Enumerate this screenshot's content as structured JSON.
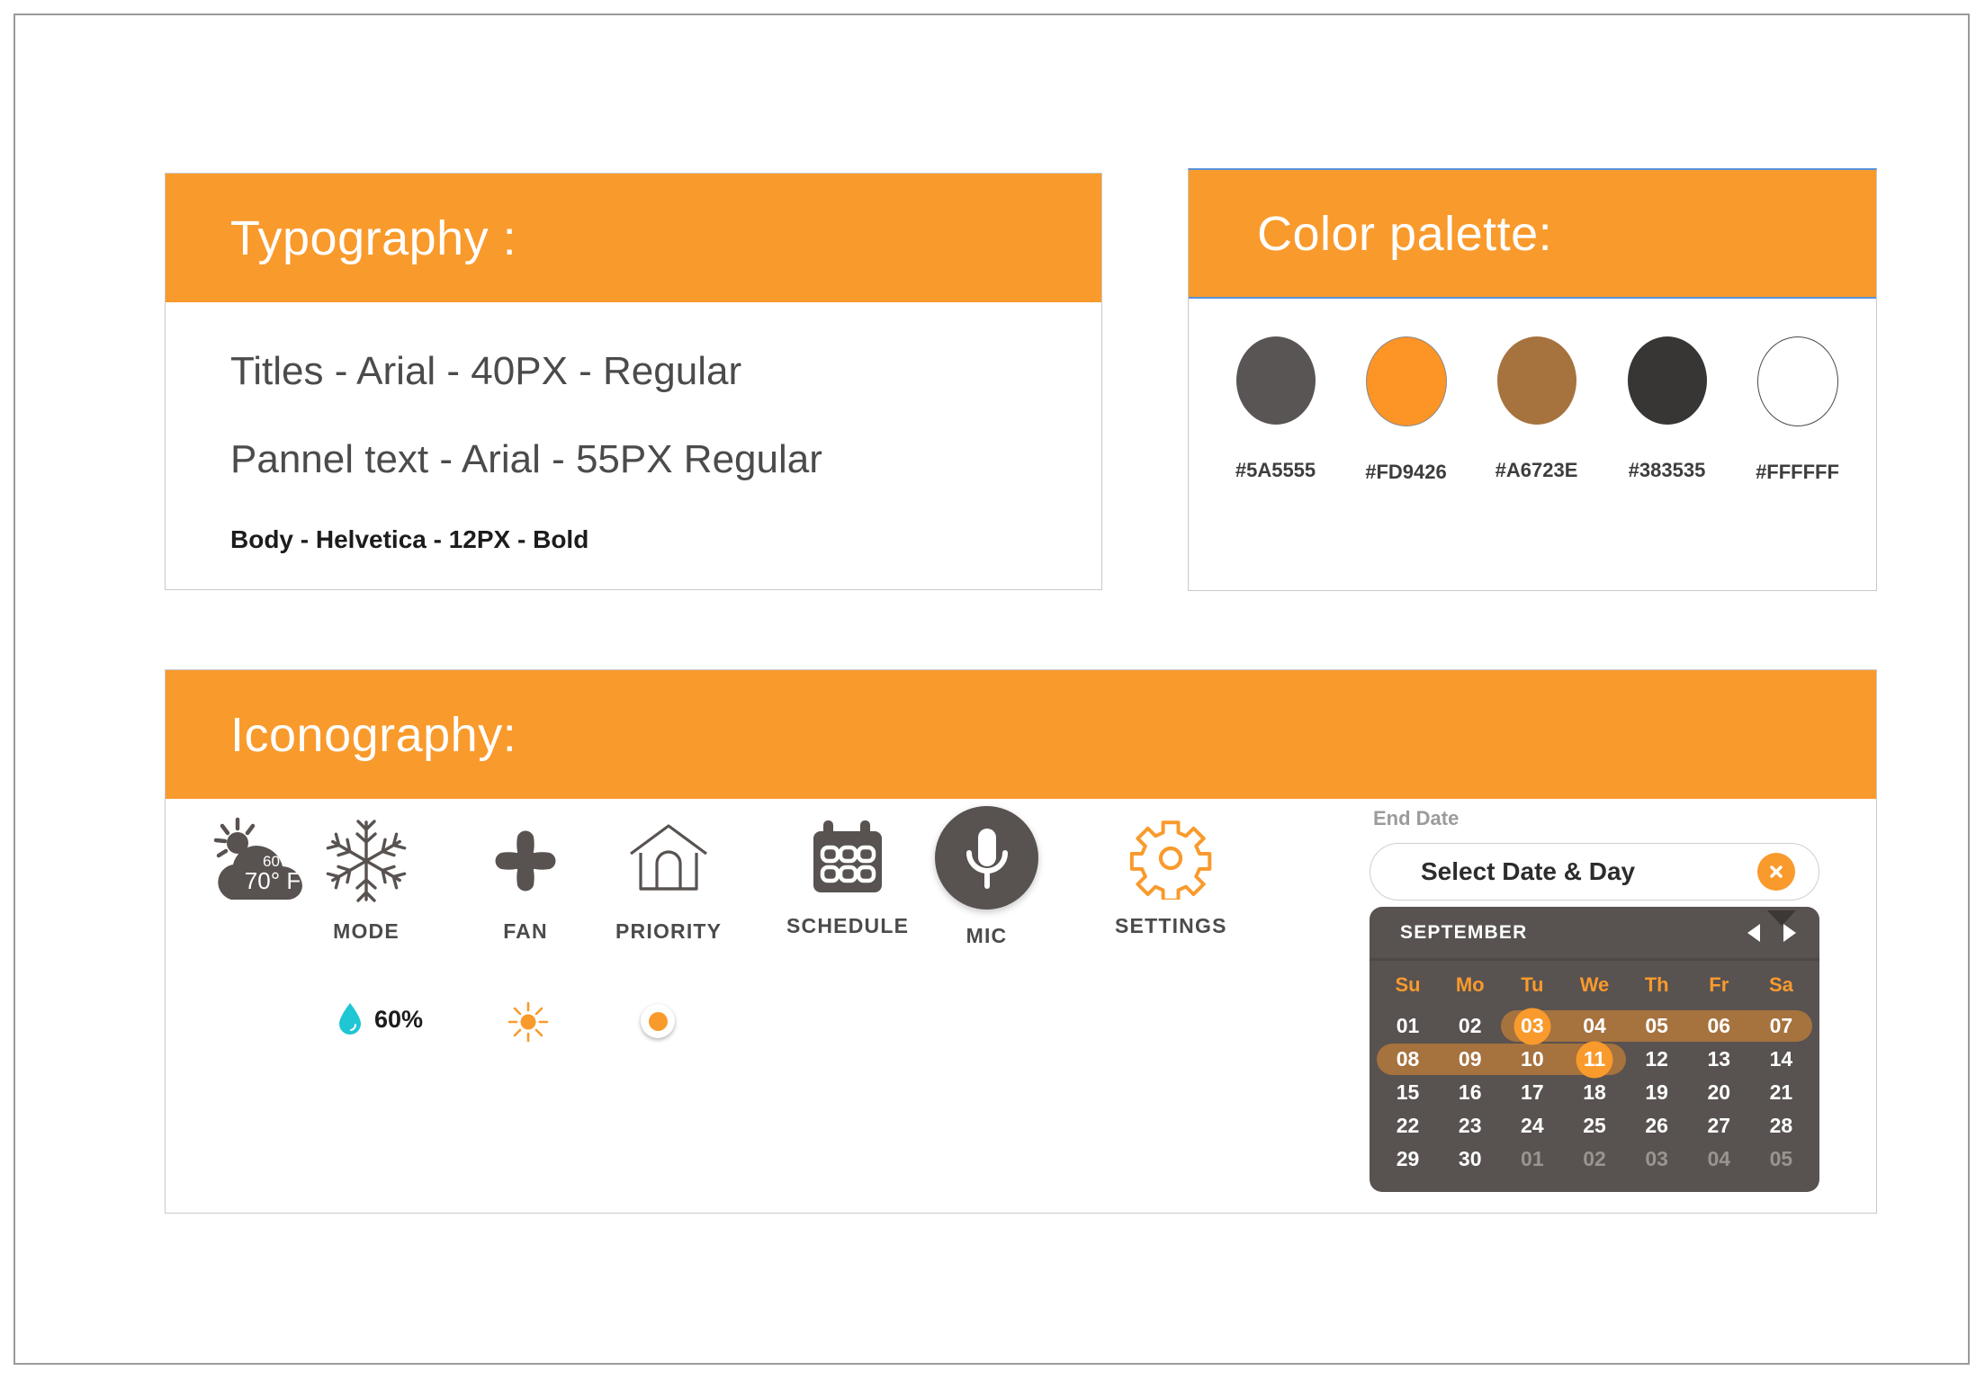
{
  "typography": {
    "header": "Typography :",
    "lines": [
      "Titles - Arial - 40PX - Regular",
      "Pannel text - Arial - 55PX Regular",
      "Body - Helvetica - 12PX - Bold"
    ]
  },
  "palette": {
    "header": "Color palette:",
    "swatches": [
      {
        "hex": "#5A5555",
        "label": "#5A5555"
      },
      {
        "hex": "#FD9426",
        "label": "#FD9426"
      },
      {
        "hex": "#A6723E",
        "label": "#A6723E"
      },
      {
        "hex": "#383535",
        "label": "#383535"
      },
      {
        "hex": "#FFFFFF",
        "label": "#FFFFFF"
      }
    ]
  },
  "iconography": {
    "header": "Iconography:",
    "weather": {
      "humidity": "60%",
      "temperature": "70° F"
    },
    "icons": [
      {
        "name": "weather-icon",
        "caption": ""
      },
      {
        "name": "snowflake-icon",
        "caption": "MODE"
      },
      {
        "name": "fan-icon",
        "caption": "FAN"
      },
      {
        "name": "house-icon",
        "caption": "PRIORITY"
      },
      {
        "name": "calendar-icon",
        "caption": "SCHEDULE"
      },
      {
        "name": "microphone-icon",
        "caption": "MIC"
      },
      {
        "name": "gear-icon",
        "caption": "SETTINGS"
      }
    ],
    "mini": {
      "humidity_value": "60%"
    }
  },
  "datepicker": {
    "label": "End Date",
    "input_value": "Select Date & Day",
    "month": "SEPTEMBER",
    "dow": [
      "Su",
      "Mo",
      "Tu",
      "We",
      "Th",
      "Fr",
      "Sa"
    ],
    "weeks": [
      [
        {
          "d": "01"
        },
        {
          "d": "02"
        },
        {
          "d": "03",
          "state": "range-start"
        },
        {
          "d": "04",
          "state": "inrange"
        },
        {
          "d": "05",
          "state": "inrange"
        },
        {
          "d": "06",
          "state": "inrange"
        },
        {
          "d": "07",
          "state": "range-end"
        }
      ],
      [
        {
          "d": "08",
          "state": "range-start-row"
        },
        {
          "d": "09",
          "state": "inrange"
        },
        {
          "d": "10",
          "state": "inrange"
        },
        {
          "d": "11",
          "state": "range-end-sel"
        },
        {
          "d": "12"
        },
        {
          "d": "13"
        },
        {
          "d": "14"
        }
      ],
      [
        {
          "d": "15"
        },
        {
          "d": "16"
        },
        {
          "d": "17"
        },
        {
          "d": "18"
        },
        {
          "d": "19"
        },
        {
          "d": "20"
        },
        {
          "d": "21"
        }
      ],
      [
        {
          "d": "22"
        },
        {
          "d": "23"
        },
        {
          "d": "24"
        },
        {
          "d": "25"
        },
        {
          "d": "26"
        },
        {
          "d": "27"
        },
        {
          "d": "28"
        }
      ],
      [
        {
          "d": "29"
        },
        {
          "d": "30"
        },
        {
          "d": "01",
          "muted": true
        },
        {
          "d": "02",
          "muted": true
        },
        {
          "d": "03",
          "muted": true
        },
        {
          "d": "04",
          "muted": true
        },
        {
          "d": "05",
          "muted": true
        }
      ]
    ]
  },
  "colors": {
    "accent_orange": "#F99A2C",
    "dark_gray": "#585250",
    "range_brown": "#A6723E",
    "teal": "#1FC6D4"
  }
}
